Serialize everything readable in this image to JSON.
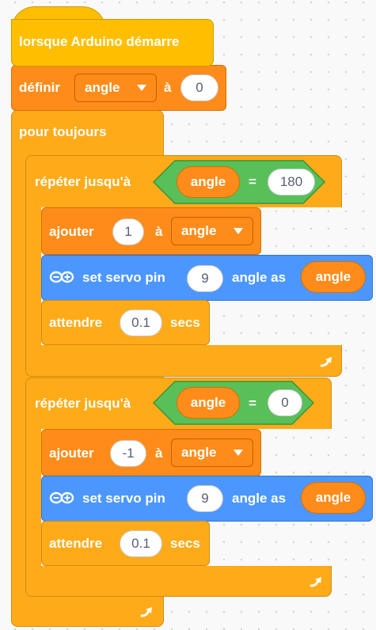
{
  "hat": {
    "label": "lorsque Arduino démarre"
  },
  "set_block": {
    "label": "définir",
    "variable": "angle",
    "to_label": "à",
    "value": "0"
  },
  "forever": {
    "label": "pour toujours"
  },
  "repeat1": {
    "label": "répéter jusqu'à",
    "cond_var": "angle",
    "op": "=",
    "cond_value": "180",
    "change": {
      "label": "ajouter",
      "value": "1",
      "to_label": "à",
      "variable": "angle"
    },
    "servo": {
      "label": "set servo pin",
      "pin": "9",
      "angle_label": "angle as",
      "reporter": "angle"
    },
    "wait": {
      "label": "attendre",
      "value": "0.1",
      "unit": "secs"
    }
  },
  "repeat2": {
    "label": "répéter jusqu'à",
    "cond_var": "angle",
    "op": "=",
    "cond_value": "0",
    "change": {
      "label": "ajouter",
      "value": "-1",
      "to_label": "à",
      "variable": "angle"
    },
    "servo": {
      "label": "set servo pin",
      "pin": "9",
      "angle_label": "angle as",
      "reporter": "angle"
    },
    "wait": {
      "label": "attendre",
      "value": "0.1",
      "unit": "secs"
    }
  },
  "colors": {
    "event": "#ffbf00",
    "control": "#ffab19",
    "variables": "#ff8c1a",
    "operators": "#59c059",
    "arduino": "#4c97ff"
  },
  "icons": {
    "loop": "loop-arrow-icon",
    "arduino": "arduino-infinity-icon",
    "dropdown": "dropdown-arrow-icon"
  }
}
